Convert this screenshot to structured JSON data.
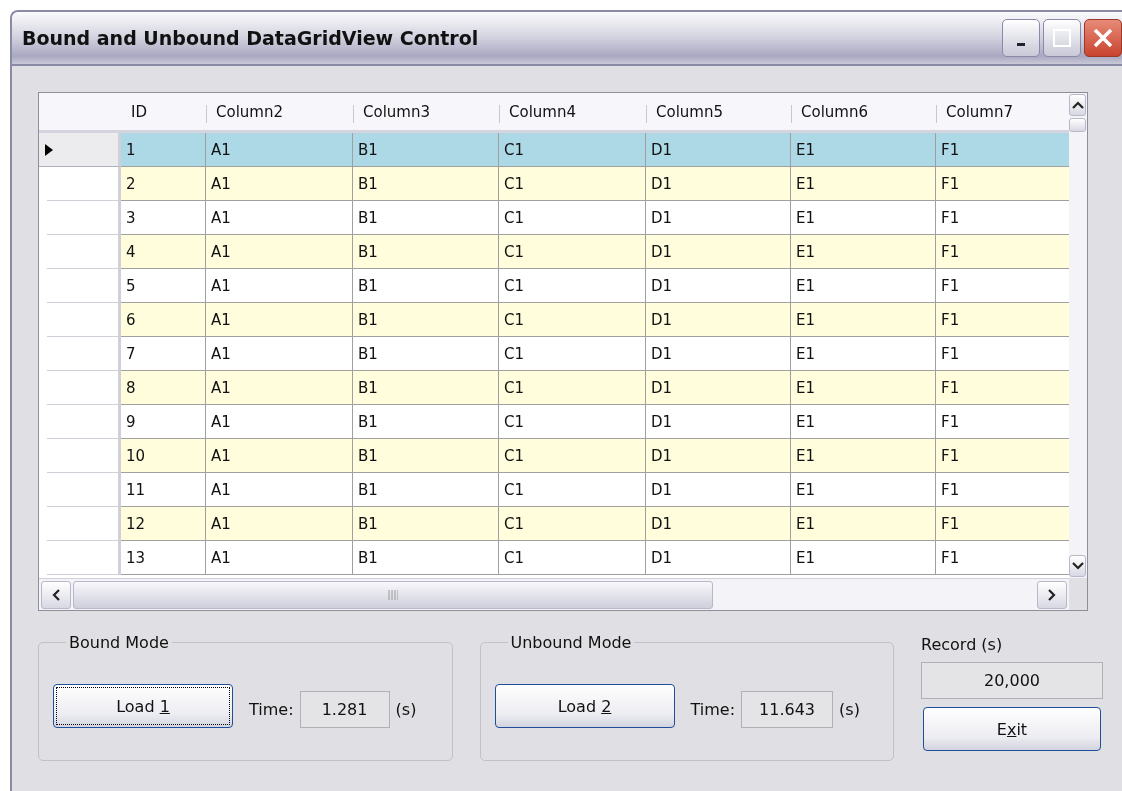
{
  "window": {
    "title": "Bound and Unbound DataGridView Control"
  },
  "table": {
    "columns": [
      "ID",
      "Column2",
      "Column3",
      "Column4",
      "Column5",
      "Column6",
      "Column7"
    ],
    "rows": [
      {
        "selected": true,
        "cells": [
          "1",
          "A1",
          "B1",
          "C1",
          "D1",
          "E1",
          "F1"
        ]
      },
      {
        "selected": false,
        "cells": [
          "2",
          "A1",
          "B1",
          "C1",
          "D1",
          "E1",
          "F1"
        ]
      },
      {
        "selected": false,
        "cells": [
          "3",
          "A1",
          "B1",
          "C1",
          "D1",
          "E1",
          "F1"
        ]
      },
      {
        "selected": false,
        "cells": [
          "4",
          "A1",
          "B1",
          "C1",
          "D1",
          "E1",
          "F1"
        ]
      },
      {
        "selected": false,
        "cells": [
          "5",
          "A1",
          "B1",
          "C1",
          "D1",
          "E1",
          "F1"
        ]
      },
      {
        "selected": false,
        "cells": [
          "6",
          "A1",
          "B1",
          "C1",
          "D1",
          "E1",
          "F1"
        ]
      },
      {
        "selected": false,
        "cells": [
          "7",
          "A1",
          "B1",
          "C1",
          "D1",
          "E1",
          "F1"
        ]
      },
      {
        "selected": false,
        "cells": [
          "8",
          "A1",
          "B1",
          "C1",
          "D1",
          "E1",
          "F1"
        ]
      },
      {
        "selected": false,
        "cells": [
          "9",
          "A1",
          "B1",
          "C1",
          "D1",
          "E1",
          "F1"
        ]
      },
      {
        "selected": false,
        "cells": [
          "10",
          "A1",
          "B1",
          "C1",
          "D1",
          "E1",
          "F1"
        ]
      },
      {
        "selected": false,
        "cells": [
          "11",
          "A1",
          "B1",
          "C1",
          "D1",
          "E1",
          "F1"
        ]
      },
      {
        "selected": false,
        "cells": [
          "12",
          "A1",
          "B1",
          "C1",
          "D1",
          "E1",
          "F1"
        ]
      },
      {
        "selected": false,
        "cells": [
          "13",
          "A1",
          "B1",
          "C1",
          "D1",
          "E1",
          "F1"
        ]
      }
    ]
  },
  "groups": [
    {
      "title": "Bound Mode",
      "button": {
        "before": "Load ",
        "key": "1",
        "focused": true
      },
      "time_label": "Time:",
      "time_value": "1.281",
      "unit": "(s)"
    },
    {
      "title": "Unbound Mode",
      "button": {
        "before": "Load ",
        "key": "2",
        "focused": false
      },
      "time_label": "Time:",
      "time_value": "11.643",
      "unit": "(s)"
    }
  ],
  "record": {
    "label": "Record (s)",
    "value": "20,000"
  },
  "exit_button": {
    "before": "E",
    "key": "x",
    "after": "it",
    "focused": false
  }
}
